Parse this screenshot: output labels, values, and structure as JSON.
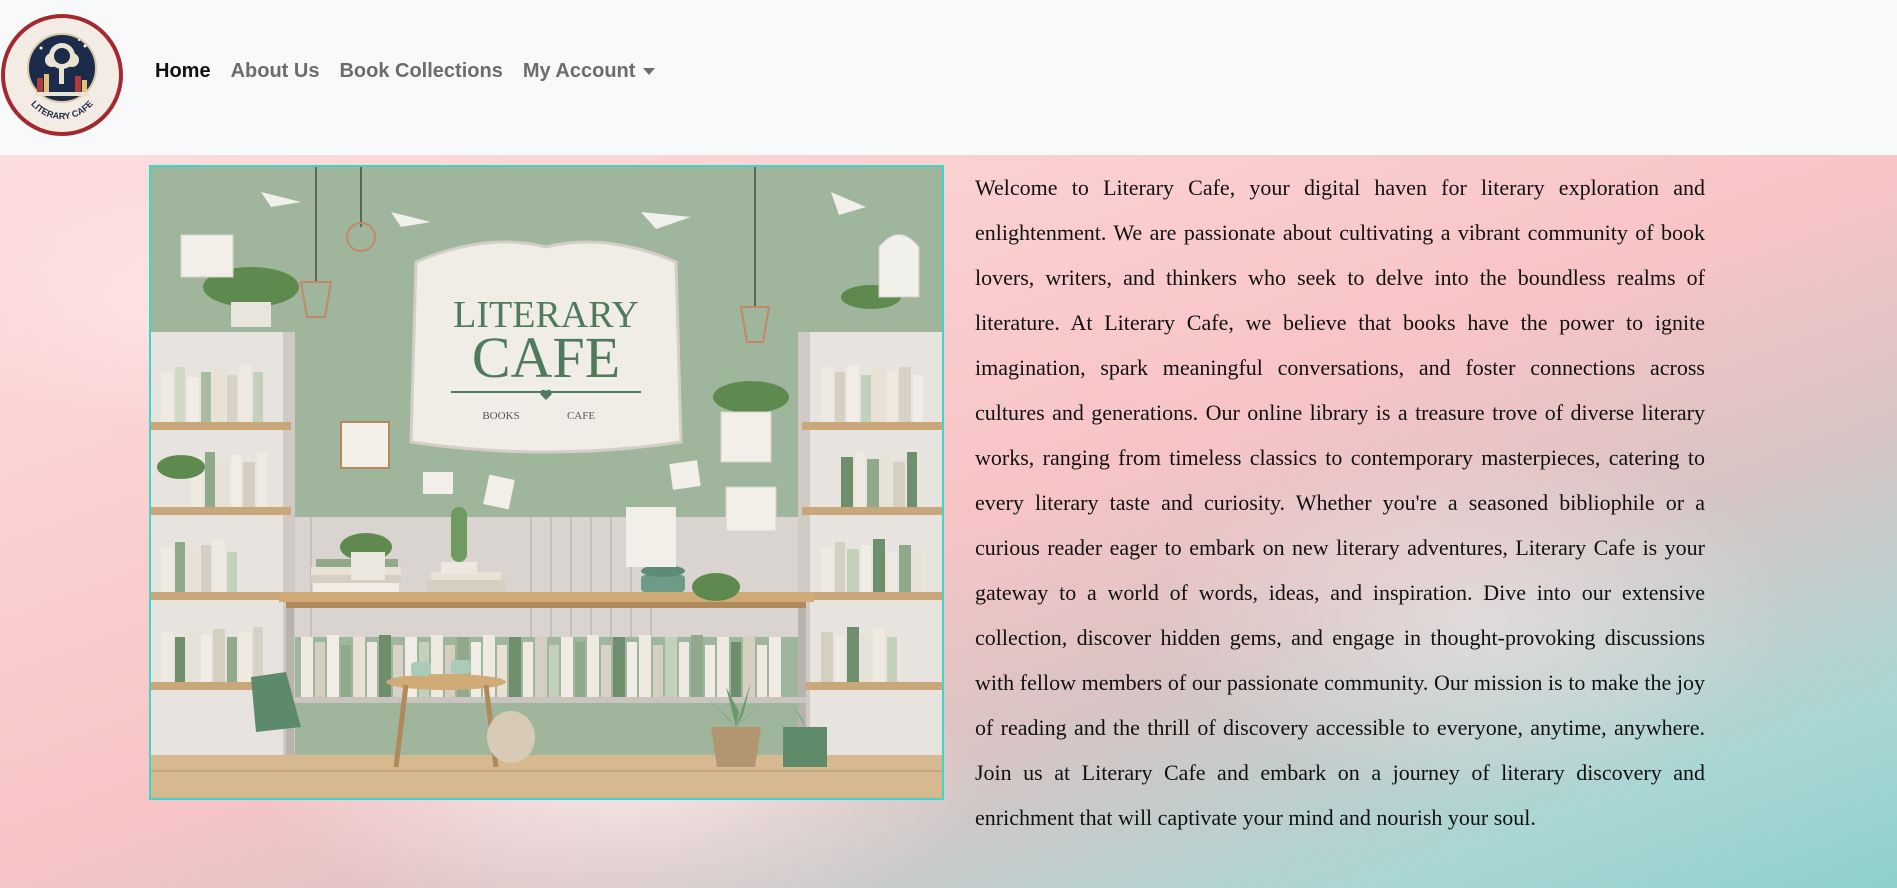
{
  "nav": {
    "logo_text": "LITERARY CAFE",
    "links": [
      {
        "label": "Home"
      },
      {
        "label": "About Us"
      },
      {
        "label": "Book Collections"
      },
      {
        "label": "My Account"
      }
    ]
  },
  "hero": {
    "sign_title_line1": "LITERARY",
    "sign_title_line2": "CAFE",
    "sign_sub_left": "BOOKS",
    "sign_sub_right": "CAFE",
    "frame_color": "#3fd6c9"
  },
  "about": {
    "paragraph": "Welcome to Literary Cafe, your digital haven for literary exploration and enlightenment. We are passionate about cultivating a vibrant community of book lovers, writers, and thinkers who seek to delve into the boundless realms of literature. At Literary Cafe, we believe that books have the power to ignite imagination, spark meaningful conversations, and foster connections across cultures and generations. Our online library is a treasure trove of diverse literary works, ranging from timeless classics to contemporary masterpieces, catering to every literary taste and curiosity. Whether you're a seasoned bibliophile or a curious reader eager to embark on new literary adventures, Literary Cafe is your gateway to a world of words, ideas, and inspiration. Dive into our extensive collection, discover hidden gems, and engage in thought-provoking discussions with fellow members of our passionate community. Our mission is to make the joy of reading and the thrill of discovery accessible to everyone, anytime, anywhere. Join us at Literary Cafe and embark on a journey of literary discovery and enrichment that will captivate your mind and nourish your soul."
  },
  "colors": {
    "logo_ring": "#a3282f",
    "nav_bg": "#f8f9fb",
    "sage": "#9db49a"
  }
}
